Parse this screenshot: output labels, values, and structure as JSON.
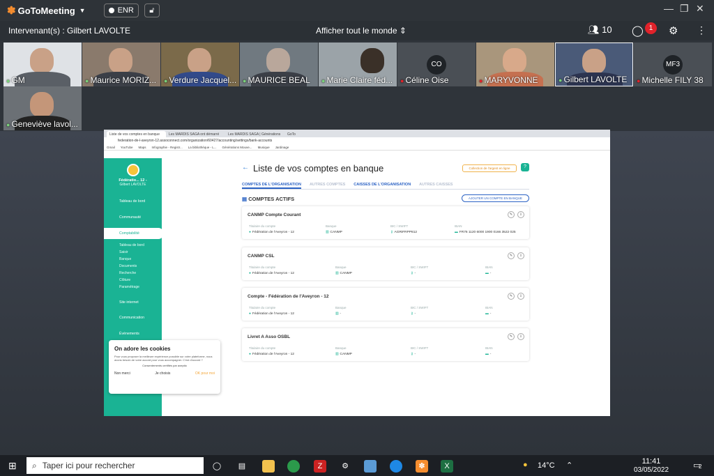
{
  "app": {
    "name": "GoToMeeting",
    "rec_label": "ENR"
  },
  "speaker_bar": {
    "speaker": "Intervenant(s) : Gilbert LAVOLTE",
    "show_all": "Afficher tout le monde",
    "participants_count": "10",
    "chat_badge": "1"
  },
  "participants": [
    {
      "name": "GM"
    },
    {
      "name": "Maurice MORIZ..."
    },
    {
      "name": "Verdure Jacquel..."
    },
    {
      "name": "MAURICE BEAL"
    },
    {
      "name": "Marie Claire féd..."
    },
    {
      "name": "Céline Oise",
      "initials": "CO"
    },
    {
      "name": "MARYVONNE"
    },
    {
      "name": "Gilbert LAVOLTE"
    },
    {
      "name": "Michelle FILY 38",
      "initials": "MF3"
    },
    {
      "name": "Geneviève lavol..."
    }
  ],
  "browser": {
    "tabs": [
      "Liste de vos comptes en banque",
      "Les MARDIS SAGA ont démarré",
      "Les MARDIS SAGA | Générations",
      "GoTo"
    ],
    "url": "federation-de-l-aveyron-12.assoconnect.com/organization/60427/accounting/settings/bank-accounts",
    "bookmarks": [
      "Gmail",
      "YouTube",
      "Maps",
      "Infographie - Registr...",
      "La bibliothèque - L...",
      "Générations Mouve...",
      "Musique",
      "Jardinage"
    ]
  },
  "sidebar": {
    "org_name": "Fédératio... 12 -",
    "user": "Gilbert LAVOLTE",
    "items": [
      "Tableau de bord",
      "Communauté",
      "Comptabilité",
      "Site internet",
      "Communication",
      "Événements"
    ],
    "subitems": [
      "Tableau de bord",
      "Saisir",
      "Banque",
      "Documents",
      "Recherche",
      "Clôture",
      "Paramétrage"
    ]
  },
  "cookie": {
    "title": "On adore les cookies",
    "text": "Pour vous proposer la meilleure expérience possible sur votre plateforme, nous avons besoin de votre accord pour vous accompagner. C'est d'accord ?",
    "certified": "Consentements certifiés par axeptio",
    "no": "Non merci",
    "choose": "Je choisis",
    "ok": "OK pour moi"
  },
  "page": {
    "back": "Retour",
    "title": "Liste de vos comptes en banque",
    "collect_btn": "Collection de l'argent en ligne",
    "help": "?",
    "tabs": [
      "COMPTES DE L'ORGANISATION",
      "AUTRES COMPTES",
      "CAISSES DE L'ORGANISATION",
      "AUTRES CAISSES"
    ],
    "section": "COMPTES ACTIFS",
    "add_btn": "AJOUTER UN COMPTE EN BANQUE",
    "field_labels": {
      "holder": "Titulaire du compte",
      "bank": "Banque",
      "bic": "BIC / SWIFT",
      "iban": "IBAN"
    },
    "accounts": [
      {
        "name": "CANMP Compte Courant",
        "holder": "Fédération de l'Aveyron - 12",
        "bank": "CANMP",
        "bic": "AGRIFRPP812",
        "iban": "FR76 1120 6000 1900 0166 3522 025"
      },
      {
        "name": "CANMP CSL",
        "holder": "Fédération de l'Aveyron - 12",
        "bank": "CANMP",
        "bic": "-",
        "iban": "-"
      },
      {
        "name": "Compte - Fédération de l'Aveyron - 12",
        "holder": "Fédération de l'Aveyron - 12",
        "bank": "-",
        "bic": "-",
        "iban": "-"
      },
      {
        "name": "Livret A Asso OSBL",
        "holder": "Fédération de l'Aveyron - 12",
        "bank": "CANMP",
        "bic": "-",
        "iban": "-"
      }
    ]
  },
  "taskbar": {
    "search_placeholder": "Taper ici pour rechercher",
    "temp": "14°C",
    "time": "11:41",
    "date": "03/05/2022",
    "notif": "2"
  },
  "colors": {
    "accent_green": "#1ab394",
    "goto_orange": "#f68d2e",
    "link_blue": "#2b62c4"
  }
}
